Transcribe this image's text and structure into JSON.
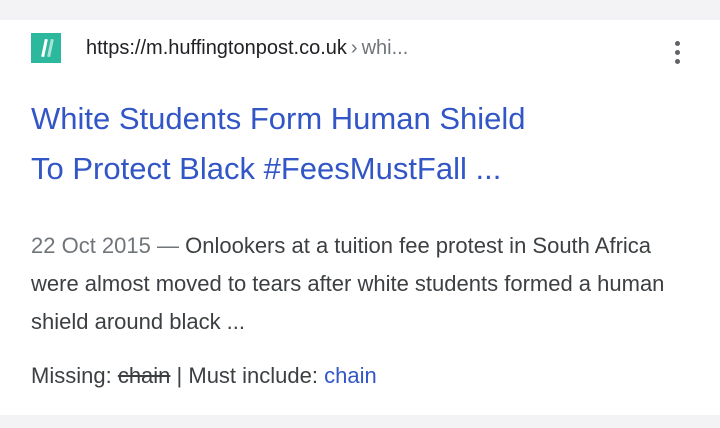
{
  "result": {
    "url": "https://m.huffingtonpost.co.uk",
    "url_separator": "›",
    "url_path": "whi...",
    "favicon": "huffpost-favicon",
    "favicon_color": "#2bb89c",
    "menu_icon": "more-vert-icon",
    "title_line1": "White Students Form Human Shield",
    "title_line2": "To Protect Black #FeesMustFall ...",
    "date": "22 Oct 2015",
    "date_separator": " — ",
    "snippet": "Onlookers at a tuition fee protest in South Africa were almost moved to tears after white students formed a human shield around black ...",
    "missing_label": "Missing:",
    "missing_term": "chain",
    "divider": "|",
    "must_include_label": "Must include:",
    "must_include_term": "chain",
    "link_color": "#3256c6"
  }
}
